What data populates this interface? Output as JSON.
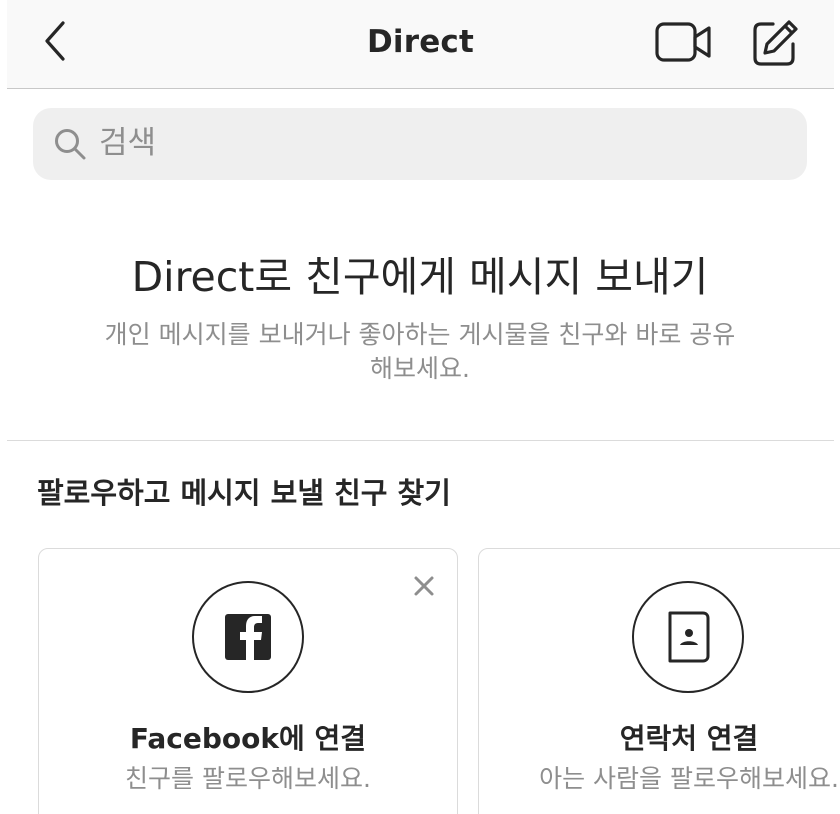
{
  "header": {
    "title": "Direct",
    "back_icon": "chevron-left-icon",
    "video_icon": "video-camera-icon",
    "compose_icon": "compose-icon"
  },
  "search": {
    "placeholder": "검색",
    "value": ""
  },
  "empty_state": {
    "title": "Direct로 친구에게 메시지 보내기",
    "subtitle": "개인 메시지를 보내거나 좋아하는 게시물을 친구와 바로 공유해보세요."
  },
  "suggestions": {
    "title": "팔로우하고 메시지 보낼 친구 찾기",
    "cards": [
      {
        "icon": "facebook-icon",
        "title": "Facebook에 연결",
        "subtitle": "친구를 팔로우해보세요.",
        "dismissible": true
      },
      {
        "icon": "contacts-icon",
        "title": "연락처 연결",
        "subtitle": "아는 사람을 팔로우해보세요.",
        "dismissible": false
      }
    ]
  },
  "colors": {
    "text_primary": "#262626",
    "text_secondary": "#8e8e8e",
    "search_bg": "#efefef",
    "header_bg": "#f9f9f9",
    "divider": "#dbdbdb"
  }
}
